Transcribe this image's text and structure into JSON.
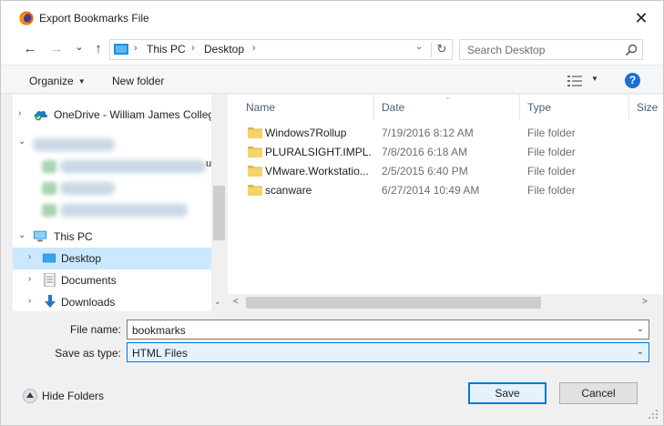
{
  "window": {
    "title": "Export Bookmarks File",
    "close_glyph": "✕"
  },
  "nav": {
    "back_glyph": "←",
    "forward_glyph": "→",
    "recent_glyph": "⌄",
    "up_glyph": "↑",
    "path": [
      "This PC",
      "Desktop"
    ],
    "path_sep": "›",
    "dropdown_glyph": "⌄",
    "refresh_glyph": "↻",
    "search_placeholder": "Search Desktop"
  },
  "commandbar": {
    "organize": "Organize",
    "new_folder": "New folder",
    "caret": "▼",
    "help": "?"
  },
  "navpane": {
    "onedrive": "OneDrive - William James Colleg",
    "thispc": "This PC",
    "items": [
      {
        "label": "Desktop",
        "selected": true
      },
      {
        "label": "Documents",
        "selected": false
      },
      {
        "label": "Downloads",
        "selected": false
      }
    ],
    "expand_glyph": "›",
    "collapse_glyph": "⌄",
    "truncation_glyph": "u"
  },
  "filelist": {
    "columns": [
      "Name",
      "Date",
      "Type",
      "Size"
    ],
    "rows": [
      {
        "name": "Windows7Rollup",
        "date": "7/19/2016 8:12 AM",
        "type": "File folder"
      },
      {
        "name": "PLURALSIGHT.IMPL...",
        "date": "7/8/2016 6:18 AM",
        "type": "File folder"
      },
      {
        "name": "VMware.Workstatio...",
        "date": "2/5/2015 6:40 PM",
        "type": "File folder"
      },
      {
        "name": "scanware",
        "date": "6/27/2014 10:49 AM",
        "type": "File folder"
      }
    ],
    "sort_glyph": "⌄",
    "scroll_left": "<",
    "scroll_right": ">"
  },
  "fields": {
    "filename_label": "File name:",
    "filename_value": "bookmarks",
    "savetype_label": "Save as type:",
    "savetype_value": "HTML Files",
    "dropdown_glyph": "⌄"
  },
  "footer": {
    "hide_folders": "Hide Folders",
    "save": "Save",
    "cancel": "Cancel"
  },
  "colors": {
    "accent": "#0078d7",
    "selection": "#cce8ff",
    "folder": "#f4d36b",
    "help": "#1a6fd3"
  }
}
